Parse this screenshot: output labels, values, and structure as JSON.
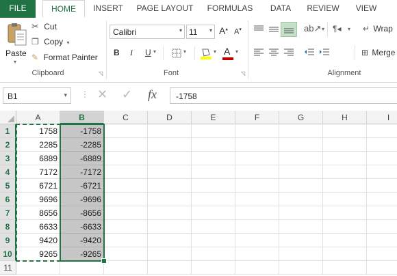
{
  "tabs": [
    "FILE",
    "HOME",
    "INSERT",
    "PAGE LAYOUT",
    "FORMULAS",
    "DATA",
    "REVIEW",
    "VIEW"
  ],
  "clipboard": {
    "paste": "Paste",
    "cut": "Cut",
    "copy": "Copy",
    "format_painter": "Format Painter",
    "label": "Clipboard"
  },
  "font": {
    "name": "Calibri",
    "size": "11",
    "label": "Font",
    "grow": "A",
    "shrink": "A",
    "bold": "B",
    "italic": "I",
    "underline": "U",
    "font_color_letter": "A"
  },
  "alignment": {
    "wrap": "Wrap",
    "merge": "Merge",
    "label": "Alignment"
  },
  "formula_bar": {
    "name_box": "B1",
    "fx": "fx",
    "value": "-1758"
  },
  "columns": [
    "A",
    "B",
    "C",
    "D",
    "E",
    "F",
    "G",
    "H",
    "I"
  ],
  "rows": [
    {
      "num": "1",
      "a": "1758",
      "b": "-1758"
    },
    {
      "num": "2",
      "a": "2285",
      "b": "-2285"
    },
    {
      "num": "3",
      "a": "6889",
      "b": "-6889"
    },
    {
      "num": "4",
      "a": "7172",
      "b": "-7172"
    },
    {
      "num": "5",
      "a": "6721",
      "b": "-6721"
    },
    {
      "num": "6",
      "a": "9696",
      "b": "-9696"
    },
    {
      "num": "7",
      "a": "8656",
      "b": "-8656"
    },
    {
      "num": "8",
      "a": "6633",
      "b": "-6633"
    },
    {
      "num": "9",
      "a": "9420",
      "b": "-9420"
    },
    {
      "num": "10",
      "a": "9265",
      "b": "-9265"
    },
    {
      "num": "11",
      "a": "",
      "b": ""
    }
  ],
  "colors": {
    "accent": "#217346",
    "selection": "#c6c6c6",
    "fill_yellow": "#ffff00",
    "font_red": "#c00000"
  }
}
